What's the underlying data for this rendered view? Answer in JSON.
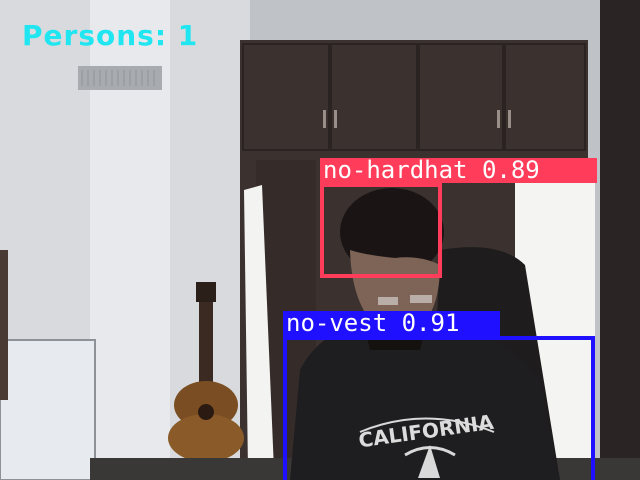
{
  "hud": {
    "persons_text": "Persons: 1",
    "color": "#1fe6f0"
  },
  "detections": {
    "hardhat": {
      "class": "no-hardhat",
      "confidence": "0.89",
      "color": "#ff3d5a"
    },
    "vest": {
      "class": "no-vest",
      "confidence": "0.91",
      "color": "#1f10ff"
    }
  },
  "scene": {
    "shirt_text": "CALIFORNIA"
  }
}
